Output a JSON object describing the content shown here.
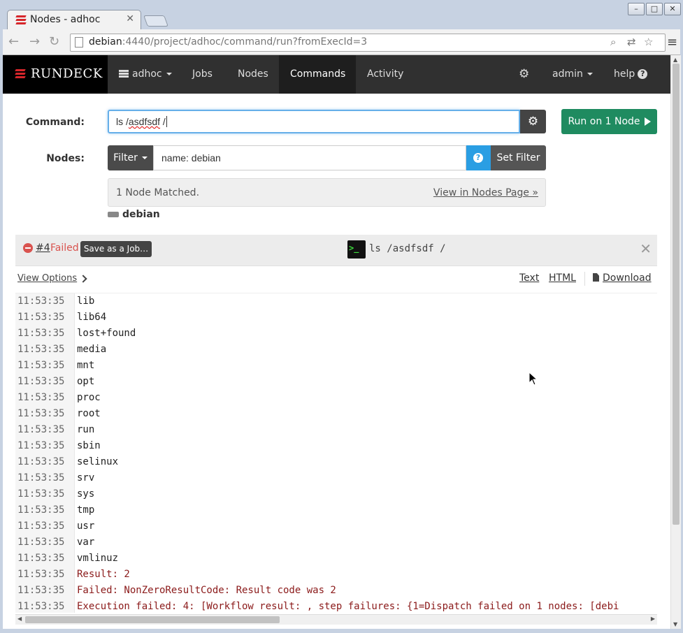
{
  "browser": {
    "tab_title": "Nodes - adhoc",
    "url_host": "debian",
    "url_rest": ":4440/project/adhoc/command/run?fromExecId=3"
  },
  "navbar": {
    "brand": "RUNDECK",
    "project": "adhoc",
    "items": [
      "Jobs",
      "Nodes",
      "Commands",
      "Activity"
    ],
    "active": "Commands",
    "user": "admin",
    "help": "help"
  },
  "command": {
    "label": "Command:",
    "value_prefix": "ls /",
    "value_misspelled": "asdfsdf",
    "value_suffix": " /",
    "run_button": "Run on 1 Node"
  },
  "nodes": {
    "label": "Nodes:",
    "filter_button": "Filter",
    "filter_value": "name: debian",
    "set_filter_button": "Set Filter",
    "matched_text": "1 Node Matched.",
    "view_link": "View in Nodes Page »",
    "node_name": "debian"
  },
  "execution": {
    "id": "#4",
    "status": "Failed",
    "save_button": "Save as a Job…",
    "terminal_glyph": ">_",
    "command": "ls /asdfsdf /",
    "view_options": "View Options",
    "formats": [
      "Text",
      "HTML"
    ],
    "download": "Download"
  },
  "log": [
    {
      "ts": "11:53:35",
      "msg": "lib",
      "error": false
    },
    {
      "ts": "11:53:35",
      "msg": "lib64",
      "error": false
    },
    {
      "ts": "11:53:35",
      "msg": "lost+found",
      "error": false
    },
    {
      "ts": "11:53:35",
      "msg": "media",
      "error": false
    },
    {
      "ts": "11:53:35",
      "msg": "mnt",
      "error": false
    },
    {
      "ts": "11:53:35",
      "msg": "opt",
      "error": false
    },
    {
      "ts": "11:53:35",
      "msg": "proc",
      "error": false
    },
    {
      "ts": "11:53:35",
      "msg": "root",
      "error": false
    },
    {
      "ts": "11:53:35",
      "msg": "run",
      "error": false
    },
    {
      "ts": "11:53:35",
      "msg": "sbin",
      "error": false
    },
    {
      "ts": "11:53:35",
      "msg": "selinux",
      "error": false
    },
    {
      "ts": "11:53:35",
      "msg": "srv",
      "error": false
    },
    {
      "ts": "11:53:35",
      "msg": "sys",
      "error": false
    },
    {
      "ts": "11:53:35",
      "msg": "tmp",
      "error": false
    },
    {
      "ts": "11:53:35",
      "msg": "usr",
      "error": false
    },
    {
      "ts": "11:53:35",
      "msg": "var",
      "error": false
    },
    {
      "ts": "11:53:35",
      "msg": "vmlinuz",
      "error": false
    },
    {
      "ts": "11:53:35",
      "msg": "Result: 2",
      "error": true
    },
    {
      "ts": "11:53:35",
      "msg": "Failed: NonZeroResultCode: Result code was 2",
      "error": true
    },
    {
      "ts": "11:53:35",
      "msg": "Execution failed: 4: [Workflow result: , step failures: {1=Dispatch failed on 1 nodes: [debi",
      "error": true
    }
  ],
  "colors": {
    "brand_red": "#d6262b",
    "run_green": "#1f8b60",
    "failed_red": "#d9534f",
    "error_text": "#8b1a1a",
    "info_blue": "#2a9ee3"
  }
}
